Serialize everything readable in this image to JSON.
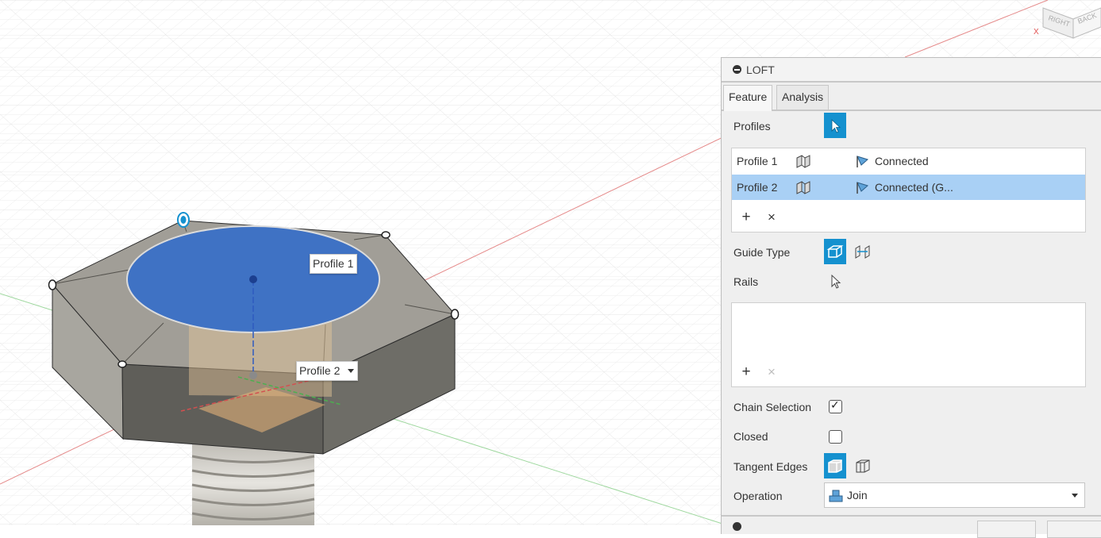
{
  "viewcube": {
    "face_right": "RIGHT",
    "face_back": "BACK",
    "axis_x": "X"
  },
  "canvas_tags": {
    "profile1": "Profile 1",
    "profile2": "Profile 2"
  },
  "loft": {
    "title": "LOFT",
    "tabs": [
      {
        "label": "Feature"
      },
      {
        "label": "Analysis"
      }
    ],
    "profiles_label": "Profiles",
    "profile_rows": [
      {
        "name": "Profile 1",
        "condition": "Connected",
        "icon": "profile-icon",
        "cond_icon": "condition-icon"
      },
      {
        "name": "Profile 2",
        "condition": "Connected (G...",
        "icon": "profile-icon",
        "cond_icon": "condition-icon"
      }
    ],
    "guide_type_label": "Guide Type",
    "rails_label": "Rails",
    "chain_selection_label": "Chain Selection",
    "chain_selection_checked": true,
    "closed_label": "Closed",
    "closed_checked": false,
    "tangent_edges_label": "Tangent Edges",
    "operation_label": "Operation",
    "operation_value": "Join",
    "add_symbol": "+",
    "remove_symbol": "×",
    "check_symbol": "✓",
    "accent_color": "#1591cf",
    "selection_color": "#a9d0f5"
  }
}
